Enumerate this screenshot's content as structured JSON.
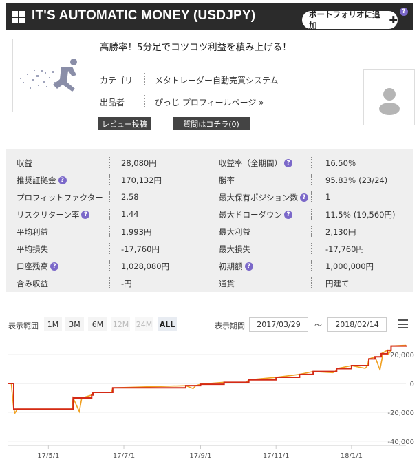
{
  "header": {
    "title": "IT'S AUTOMATIC MONEY (USDJPY)",
    "portfolio_button": "ポートフォリオに追加",
    "help_icon": "?"
  },
  "system": {
    "headline": "高勝率！5分足でコツコツ利益を積み上げる！",
    "category_label": "カテゴリ",
    "category_value": "メタトレーダー自動売買システム",
    "seller_label": "出品者",
    "seller_value": "ぴっじ プロフィールページ »",
    "review_button": "レビュー投稿",
    "question_button": "質問はコチラ(0)",
    "thumbnail_icon": "running-figure-image",
    "avatar_icon": "user-silhouette"
  },
  "stats": {
    "help_mark": "?",
    "left": [
      {
        "label": "収益",
        "value": "28,080円",
        "help": false
      },
      {
        "label": "推奨証拠金",
        "value": "170,132円",
        "help": true
      },
      {
        "label": "プロフィットファクター",
        "value": "2.58",
        "help": false
      },
      {
        "label": "リスクリターン率",
        "value": "1.44",
        "help": true
      },
      {
        "label": "平均利益",
        "value": "1,993円",
        "help": false
      },
      {
        "label": "平均損失",
        "value": "-17,760円",
        "help": false
      },
      {
        "label": "口座残高",
        "value": "1,028,080円",
        "help": true
      },
      {
        "label": "含み収益",
        "value": "-円",
        "help": false
      }
    ],
    "right": [
      {
        "label": "収益率（全期間）",
        "value": "16.50％",
        "help": true
      },
      {
        "label": "勝率",
        "value": "95.83％ (23/24)",
        "help": false
      },
      {
        "label": "最大保有ポジション数",
        "value": "1",
        "help": true
      },
      {
        "label": "最大ドローダウン",
        "value": "11.5％ (19,560円)",
        "help": true
      },
      {
        "label": "最大利益",
        "value": "2,130円",
        "help": false
      },
      {
        "label": "最大損失",
        "value": "-17,760円",
        "help": false
      },
      {
        "label": "初期額",
        "value": "1,000,000円",
        "help": true
      },
      {
        "label": "通貨",
        "value": "円建て",
        "help": false
      }
    ]
  },
  "chart_controls": {
    "range_label": "表示範囲",
    "ranges": [
      {
        "label": "1M",
        "state": "normal"
      },
      {
        "label": "3M",
        "state": "normal"
      },
      {
        "label": "6M",
        "state": "normal"
      },
      {
        "label": "12M",
        "state": "disabled"
      },
      {
        "label": "24M",
        "state": "disabled"
      },
      {
        "label": "ALL",
        "state": "active"
      }
    ],
    "period_label": "表示期間",
    "start_date": "2017/03/29",
    "tilde": "～",
    "end_date": "2018/02/14"
  },
  "chart_data": {
    "type": "line",
    "x_ticks": [
      "17/5/1",
      "17/7/1",
      "17/9/1",
      "17/11/1",
      "18/1/1"
    ],
    "y_ticks": [
      "20,000",
      "0",
      "-20,000",
      "-40,000"
    ],
    "ylim": [
      -42000,
      32000
    ],
    "series_colors": {
      "balance": "#d42a16",
      "equity": "#f0a020"
    },
    "balance": [
      [
        "2017-03-29",
        0
      ],
      [
        "2017-04-01",
        0
      ],
      [
        "2017-04-03",
        -17760
      ],
      [
        "2017-05-20",
        -17760
      ],
      [
        "2017-05-21",
        -10000
      ],
      [
        "2017-06-05",
        -8000
      ],
      [
        "2017-06-06",
        -6200
      ],
      [
        "2017-06-21",
        -6200
      ],
      [
        "2017-06-22",
        -3000
      ],
      [
        "2017-08-20",
        -1500
      ],
      [
        "2017-09-01",
        -500
      ],
      [
        "2017-09-20",
        800
      ],
      [
        "2017-10-10",
        2500
      ],
      [
        "2017-11-01",
        4300
      ],
      [
        "2017-11-20",
        6300
      ],
      [
        "2017-12-01",
        8300
      ],
      [
        "2017-12-20",
        10300
      ],
      [
        "2018-01-01",
        12400
      ],
      [
        "2018-01-15",
        17000
      ],
      [
        "2018-01-20",
        18500
      ],
      [
        "2018-01-25",
        20600
      ],
      [
        "2018-01-30",
        23000
      ],
      [
        "2018-02-02",
        26000
      ],
      [
        "2018-02-14",
        26500
      ]
    ],
    "equity_dips": [
      [
        "2017-04-04",
        -20500
      ],
      [
        "2017-05-26",
        -19500
      ],
      [
        "2017-08-26",
        -3500
      ],
      [
        "2017-10-06",
        700
      ],
      [
        "2017-12-17",
        7500
      ],
      [
        "2018-01-12",
        10500
      ],
      [
        "2018-01-24",
        9500
      ],
      [
        "2018-01-31",
        20500
      ]
    ]
  }
}
